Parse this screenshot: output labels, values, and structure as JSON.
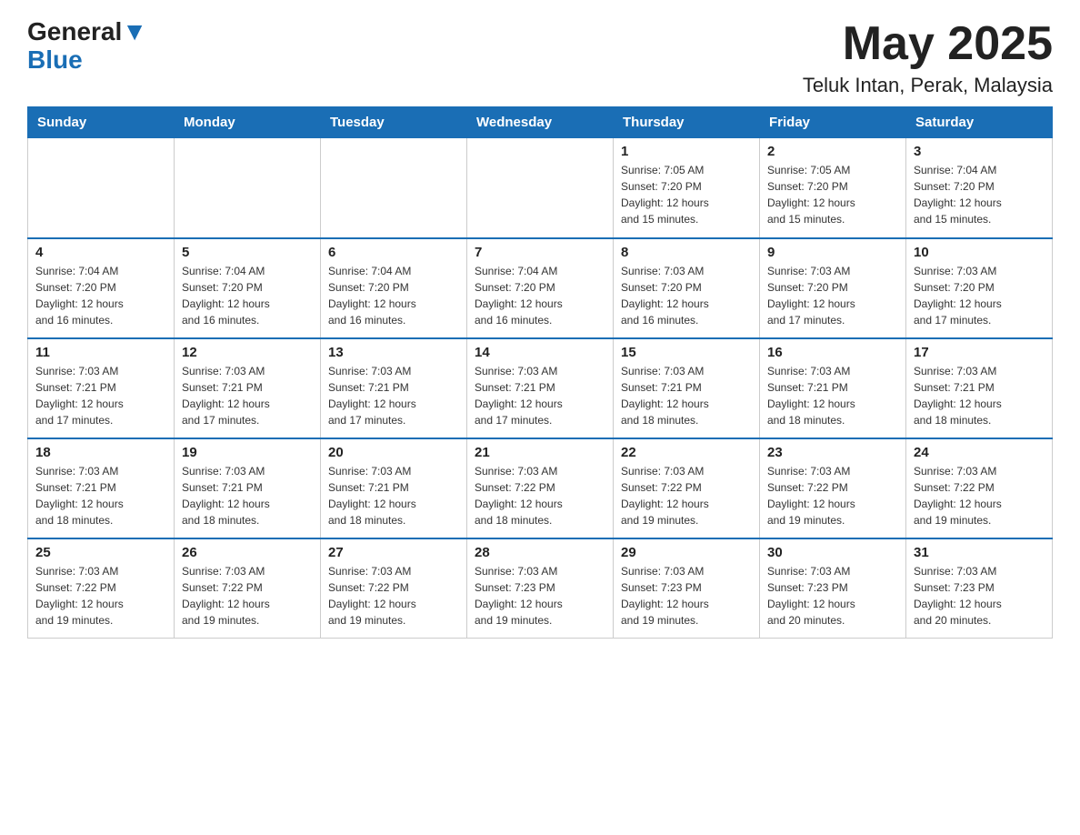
{
  "header": {
    "logo_main": "General",
    "logo_accent": "Blue",
    "month_year": "May 2025",
    "location": "Teluk Intan, Perak, Malaysia"
  },
  "days_of_week": [
    "Sunday",
    "Monday",
    "Tuesday",
    "Wednesday",
    "Thursday",
    "Friday",
    "Saturday"
  ],
  "weeks": [
    [
      {
        "day": "",
        "info": ""
      },
      {
        "day": "",
        "info": ""
      },
      {
        "day": "",
        "info": ""
      },
      {
        "day": "",
        "info": ""
      },
      {
        "day": "1",
        "info": "Sunrise: 7:05 AM\nSunset: 7:20 PM\nDaylight: 12 hours\nand 15 minutes."
      },
      {
        "day": "2",
        "info": "Sunrise: 7:05 AM\nSunset: 7:20 PM\nDaylight: 12 hours\nand 15 minutes."
      },
      {
        "day": "3",
        "info": "Sunrise: 7:04 AM\nSunset: 7:20 PM\nDaylight: 12 hours\nand 15 minutes."
      }
    ],
    [
      {
        "day": "4",
        "info": "Sunrise: 7:04 AM\nSunset: 7:20 PM\nDaylight: 12 hours\nand 16 minutes."
      },
      {
        "day": "5",
        "info": "Sunrise: 7:04 AM\nSunset: 7:20 PM\nDaylight: 12 hours\nand 16 minutes."
      },
      {
        "day": "6",
        "info": "Sunrise: 7:04 AM\nSunset: 7:20 PM\nDaylight: 12 hours\nand 16 minutes."
      },
      {
        "day": "7",
        "info": "Sunrise: 7:04 AM\nSunset: 7:20 PM\nDaylight: 12 hours\nand 16 minutes."
      },
      {
        "day": "8",
        "info": "Sunrise: 7:03 AM\nSunset: 7:20 PM\nDaylight: 12 hours\nand 16 minutes."
      },
      {
        "day": "9",
        "info": "Sunrise: 7:03 AM\nSunset: 7:20 PM\nDaylight: 12 hours\nand 17 minutes."
      },
      {
        "day": "10",
        "info": "Sunrise: 7:03 AM\nSunset: 7:20 PM\nDaylight: 12 hours\nand 17 minutes."
      }
    ],
    [
      {
        "day": "11",
        "info": "Sunrise: 7:03 AM\nSunset: 7:21 PM\nDaylight: 12 hours\nand 17 minutes."
      },
      {
        "day": "12",
        "info": "Sunrise: 7:03 AM\nSunset: 7:21 PM\nDaylight: 12 hours\nand 17 minutes."
      },
      {
        "day": "13",
        "info": "Sunrise: 7:03 AM\nSunset: 7:21 PM\nDaylight: 12 hours\nand 17 minutes."
      },
      {
        "day": "14",
        "info": "Sunrise: 7:03 AM\nSunset: 7:21 PM\nDaylight: 12 hours\nand 17 minutes."
      },
      {
        "day": "15",
        "info": "Sunrise: 7:03 AM\nSunset: 7:21 PM\nDaylight: 12 hours\nand 18 minutes."
      },
      {
        "day": "16",
        "info": "Sunrise: 7:03 AM\nSunset: 7:21 PM\nDaylight: 12 hours\nand 18 minutes."
      },
      {
        "day": "17",
        "info": "Sunrise: 7:03 AM\nSunset: 7:21 PM\nDaylight: 12 hours\nand 18 minutes."
      }
    ],
    [
      {
        "day": "18",
        "info": "Sunrise: 7:03 AM\nSunset: 7:21 PM\nDaylight: 12 hours\nand 18 minutes."
      },
      {
        "day": "19",
        "info": "Sunrise: 7:03 AM\nSunset: 7:21 PM\nDaylight: 12 hours\nand 18 minutes."
      },
      {
        "day": "20",
        "info": "Sunrise: 7:03 AM\nSunset: 7:21 PM\nDaylight: 12 hours\nand 18 minutes."
      },
      {
        "day": "21",
        "info": "Sunrise: 7:03 AM\nSunset: 7:22 PM\nDaylight: 12 hours\nand 18 minutes."
      },
      {
        "day": "22",
        "info": "Sunrise: 7:03 AM\nSunset: 7:22 PM\nDaylight: 12 hours\nand 19 minutes."
      },
      {
        "day": "23",
        "info": "Sunrise: 7:03 AM\nSunset: 7:22 PM\nDaylight: 12 hours\nand 19 minutes."
      },
      {
        "day": "24",
        "info": "Sunrise: 7:03 AM\nSunset: 7:22 PM\nDaylight: 12 hours\nand 19 minutes."
      }
    ],
    [
      {
        "day": "25",
        "info": "Sunrise: 7:03 AM\nSunset: 7:22 PM\nDaylight: 12 hours\nand 19 minutes."
      },
      {
        "day": "26",
        "info": "Sunrise: 7:03 AM\nSunset: 7:22 PM\nDaylight: 12 hours\nand 19 minutes."
      },
      {
        "day": "27",
        "info": "Sunrise: 7:03 AM\nSunset: 7:22 PM\nDaylight: 12 hours\nand 19 minutes."
      },
      {
        "day": "28",
        "info": "Sunrise: 7:03 AM\nSunset: 7:23 PM\nDaylight: 12 hours\nand 19 minutes."
      },
      {
        "day": "29",
        "info": "Sunrise: 7:03 AM\nSunset: 7:23 PM\nDaylight: 12 hours\nand 19 minutes."
      },
      {
        "day": "30",
        "info": "Sunrise: 7:03 AM\nSunset: 7:23 PM\nDaylight: 12 hours\nand 20 minutes."
      },
      {
        "day": "31",
        "info": "Sunrise: 7:03 AM\nSunset: 7:23 PM\nDaylight: 12 hours\nand 20 minutes."
      }
    ]
  ]
}
